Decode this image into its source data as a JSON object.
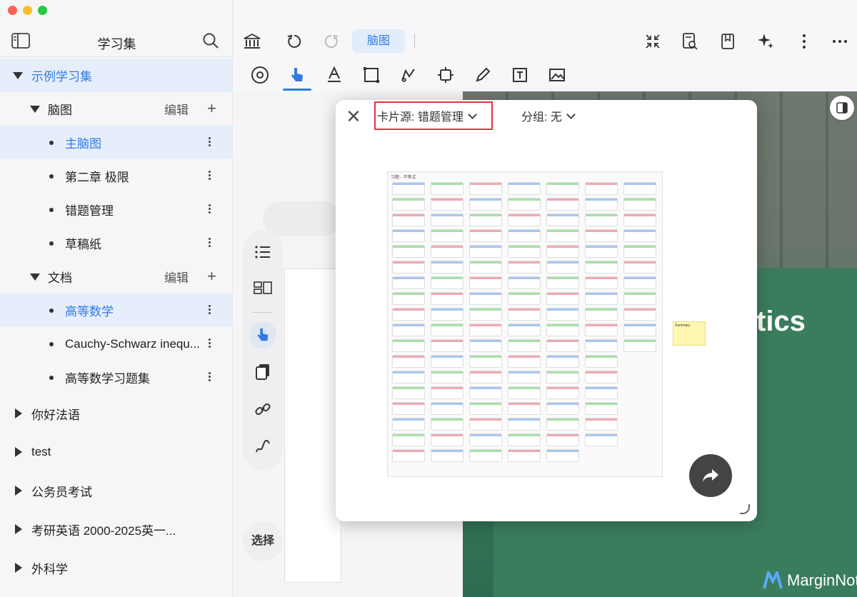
{
  "sidebar": {
    "title": "学习集",
    "items": [
      {
        "label": "示例学习集",
        "level": 0,
        "expanded": true,
        "selected": true
      },
      {
        "label": "脑图",
        "level": 1,
        "expanded": true,
        "edit": "编辑"
      },
      {
        "label": "主脑图",
        "level": 2,
        "selected": true
      },
      {
        "label": "第二章 极限",
        "level": 2
      },
      {
        "label": "错题管理",
        "level": 2
      },
      {
        "label": "草稿纸",
        "level": 2
      },
      {
        "label": "文档",
        "level": 1,
        "expanded": true,
        "edit": "编辑"
      },
      {
        "label": "高等数学",
        "level": 2,
        "selected": true
      },
      {
        "label": "Cauchy-Schwarz inequ...",
        "level": 2
      },
      {
        "label": "高等数学习题集",
        "level": 2
      },
      {
        "label": "你好法语",
        "level": 0
      },
      {
        "label": "test",
        "level": 0
      },
      {
        "label": "公务员考试",
        "level": 0
      },
      {
        "label": "考研英语 2000-2025英一...",
        "level": 0
      },
      {
        "label": "外科学",
        "level": 0
      }
    ]
  },
  "toolbar": {
    "active_tab": "脑图"
  },
  "float_tools": {
    "select_label": "选择"
  },
  "panel": {
    "card_source": "卡片源: 错题管理",
    "group": "分组: 无",
    "preview_title": "习题 - 不等式",
    "summary": "Summary"
  },
  "document": {
    "partial_text": "tics",
    "brand": "MarginNot"
  },
  "colors": {
    "accent": "#2f7be2",
    "highlight_border": "#e0343a"
  }
}
